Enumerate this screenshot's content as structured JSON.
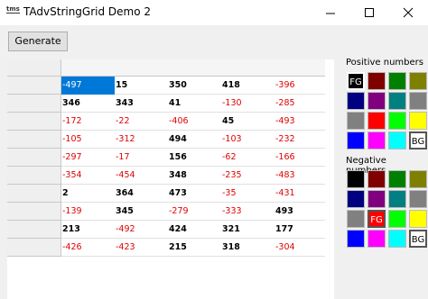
{
  "window": {
    "title": "TAdvStringGrid Demo 2",
    "app_icon_text": "tms"
  },
  "toolbar": {
    "generate_label": "Generate"
  },
  "grid": {
    "rows": [
      [
        -497,
        15,
        350,
        418,
        -396
      ],
      [
        346,
        343,
        41,
        -130,
        -285
      ],
      [
        -172,
        -22,
        -406,
        45,
        -493
      ],
      [
        -105,
        -312,
        494,
        -103,
        -232
      ],
      [
        -297,
        -17,
        156,
        -62,
        -166
      ],
      [
        -354,
        -454,
        348,
        -235,
        -483
      ],
      [
        2,
        364,
        473,
        -35,
        -431
      ],
      [
        -139,
        345,
        -279,
        -333,
        493
      ],
      [
        213,
        -492,
        424,
        321,
        177
      ],
      [
        -426,
        -423,
        215,
        318,
        -304
      ]
    ],
    "selected_cell": "-497"
  },
  "positive_panel": {
    "label": "Positive numbers",
    "colors": [
      "#000000",
      "#800000",
      "#008000",
      "#808000",
      "#000080",
      "#800080",
      "#008080",
      "#808080",
      "#808080",
      "#ff0000",
      "#00ff00",
      "#ffff00",
      "#0000ff",
      "#ff00ff",
      "#00ffff",
      "#ffffff"
    ],
    "fg_label": "FG",
    "bg_label": "BG"
  },
  "negative_panel": {
    "label": "Negative numbers",
    "colors": [
      "#000000",
      "#800000",
      "#008000",
      "#808000",
      "#000080",
      "#800080",
      "#008080",
      "#808080",
      "#808080",
      "#ff0000",
      "#00ff00",
      "#ffff00",
      "#0000ff",
      "#ff00ff",
      "#00ffff",
      "#ffffff"
    ],
    "fg_label": "FG",
    "bg_label": "BG"
  }
}
